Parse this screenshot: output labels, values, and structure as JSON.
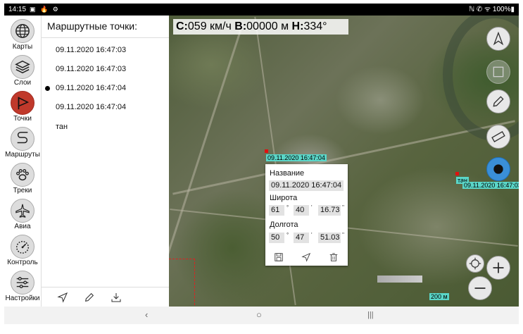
{
  "statusbar": {
    "time": "14:15",
    "status_icons": "▣ 🔥 ⚙",
    "right": "ℕ ✆ ᯤ 100%▮"
  },
  "sidebar": {
    "items": [
      {
        "label": "Карты",
        "icon": "globe-icon"
      },
      {
        "label": "Слои",
        "icon": "layers-icon"
      },
      {
        "label": "Точки",
        "icon": "flag-icon"
      },
      {
        "label": "Маршруты",
        "icon": "route-icon"
      },
      {
        "label": "Треки",
        "icon": "paw-icon"
      },
      {
        "label": "Авиа",
        "icon": "airplane-icon"
      },
      {
        "label": "Контроль",
        "icon": "gauge-icon"
      },
      {
        "label": "Настройки",
        "icon": "sliders-icon"
      }
    ]
  },
  "waypoints": {
    "title": "Маршрутные точки:",
    "items": [
      "09.11.2020 16:47:03",
      "09.11.2020 16:47:03",
      "09.11.2020 16:47:04",
      "09.11.2020 16:47:04",
      "тан"
    ],
    "toolbar": {
      "navigate_icon": "navigate-icon",
      "edit_icon": "pencil-icon",
      "download_icon": "download-icon"
    }
  },
  "map": {
    "speed_label": "С:",
    "speed_value": "059 км/ч",
    "alt_label": "В:",
    "alt_value": "00000 м",
    "heading_label": "Н:",
    "heading_value": "334°",
    "point_label_1": "09.11.2020 16:47:04",
    "point_label_2": "тан",
    "point_label_3": "09.11.2020 16:47:03",
    "scale_label": "200 м",
    "buttons": [
      "compass-icon",
      "frame-icon",
      "pencil-icon",
      "ruler-icon",
      "location-icon",
      "crosshair-icon",
      "zoom-in-icon",
      "zoom-out-icon"
    ]
  },
  "popup": {
    "name_label": "Название",
    "name_value": "09.11.2020 16:47:04",
    "lat_label": "Широта",
    "lat_deg": "61",
    "lat_min": "40",
    "lat_sec": "16.73",
    "lon_label": "Долгота",
    "lon_deg": "50",
    "lon_min": "47",
    "lon_sec": "51.03",
    "deg_symbol": "°",
    "min_symbol": "'",
    "sec_symbol": "''"
  },
  "navbar": {
    "back": "‹",
    "home": "○",
    "recents": "|||"
  },
  "colors": {
    "active_nav": "#c0392b",
    "label_bg": "#5ad6c8",
    "location_btn": "#3a8fd8"
  }
}
